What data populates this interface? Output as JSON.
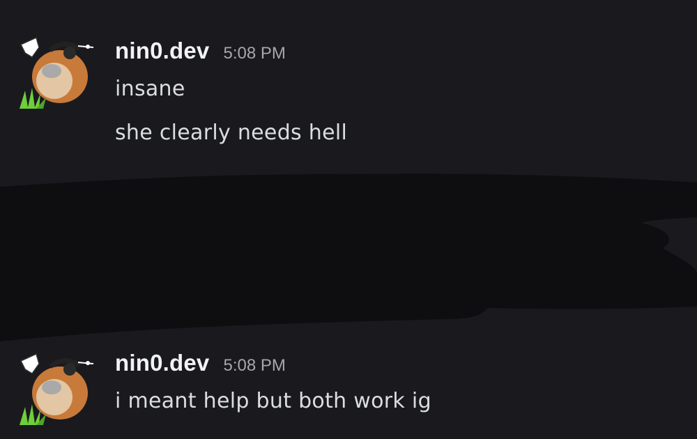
{
  "messages": [
    {
      "author": "nin0.dev",
      "timestamp": "5:08 PM",
      "avatar_icon": "hamster-avatar-icon",
      "lines": [
        "insane",
        "she clearly needs hell"
      ]
    },
    {
      "author": "nin0.dev",
      "timestamp": "5:08 PM",
      "avatar_icon": "hamster-avatar-icon",
      "lines": [
        "i meant help but both work ig"
      ]
    }
  ],
  "colors": {
    "background": "#1a1a1e",
    "username": "#f2f3f5",
    "timestamp": "#a6a7ad",
    "message_text": "#dbdee1",
    "redaction": "#0e0e10"
  }
}
